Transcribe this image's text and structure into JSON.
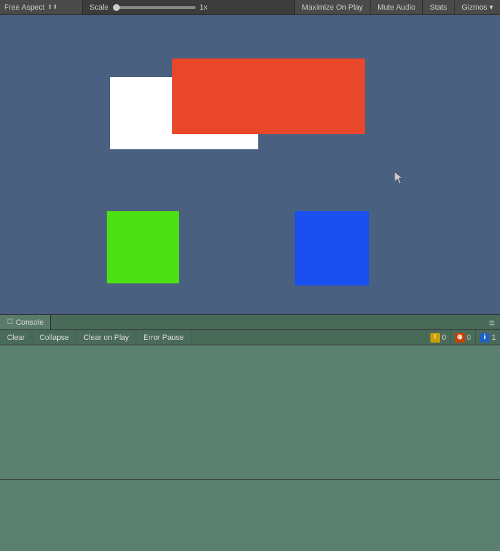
{
  "toolbar": {
    "aspect_label": "Free Aspect",
    "aspect_arrows": "⬆⬇",
    "scale_label": "Scale",
    "scale_value": "1x",
    "maximize_on_play": "Maximize On Play",
    "mute_audio": "Mute Audio",
    "stats": "Stats",
    "gizmos": "Gizmos",
    "gizmos_arrow": "▾"
  },
  "console": {
    "tab_icon": "☰",
    "tab_label": "Console",
    "menu_icon": "≡",
    "clear": "Clear",
    "collapse": "Collapse",
    "clear_on_play": "Clear on Play",
    "error_pause": "Error Pause",
    "warning_count": "0",
    "error_count": "0",
    "info_count": "1",
    "warning_icon": "⚠",
    "error_icon": "⊗",
    "info_icon": "ℹ"
  },
  "shapes": {
    "white": {
      "label": "white rectangle"
    },
    "red": {
      "label": "red rectangle"
    },
    "green": {
      "label": "green square"
    },
    "blue": {
      "label": "blue square"
    }
  }
}
